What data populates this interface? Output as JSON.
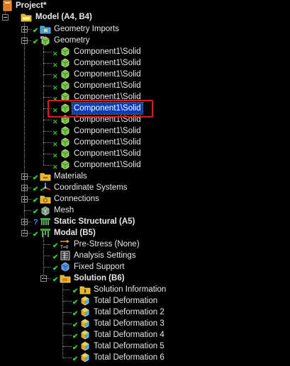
{
  "tree": {
    "root": {
      "label": "Project*",
      "icon": "project-icon"
    },
    "model": {
      "label": "Model (A4, B4)",
      "icon": "model-icon"
    },
    "geometry_imports": {
      "label": "Geometry Imports",
      "icon": "geometry-imports-icon"
    },
    "geometry": {
      "label": "Geometry",
      "icon": "geometry-icon"
    },
    "components": [
      "Component1\\Solid",
      "Component1\\Solid",
      "Component1\\Solid",
      "Component1\\Solid",
      "Component1\\Solid",
      "Component1\\Solid",
      "Component1\\Solid",
      "Component1\\Solid",
      "Component1\\Solid",
      "Component1\\Solid",
      "Component1\\Solid"
    ],
    "selected_component_index": 5,
    "materials": {
      "label": "Materials",
      "icon": "materials-icon"
    },
    "coordinate_systems": {
      "label": "Coordinate Systems",
      "icon": "coordinate-systems-icon"
    },
    "connections": {
      "label": "Connections",
      "icon": "connections-icon"
    },
    "mesh": {
      "label": "Mesh",
      "icon": "mesh-icon"
    },
    "static_structural": {
      "label": "Static Structural (A5)",
      "icon": "static-structural-icon"
    },
    "modal": {
      "label": "Modal (B5)",
      "icon": "modal-icon"
    },
    "pre_stress": {
      "label": "Pre-Stress (None)",
      "icon": "pre-stress-icon",
      "icon_text": "T=0"
    },
    "analysis_settings": {
      "label": "Analysis Settings",
      "icon": "analysis-settings-icon"
    },
    "fixed_support": {
      "label": "Fixed Support",
      "icon": "fixed-support-icon"
    },
    "solution": {
      "label": "Solution (B6)",
      "icon": "solution-icon"
    },
    "solution_information": {
      "label": "Solution Information",
      "icon": "solution-information-icon"
    },
    "total_deformations": [
      "Total Deformation",
      "Total Deformation 2",
      "Total Deformation 3",
      "Total Deformation 4",
      "Total Deformation 5",
      "Total Deformation 6"
    ]
  },
  "colors": {
    "background": "#000000",
    "selection": "#0a3cc0",
    "highlight_box": "#d22020",
    "check": "#39d139"
  }
}
